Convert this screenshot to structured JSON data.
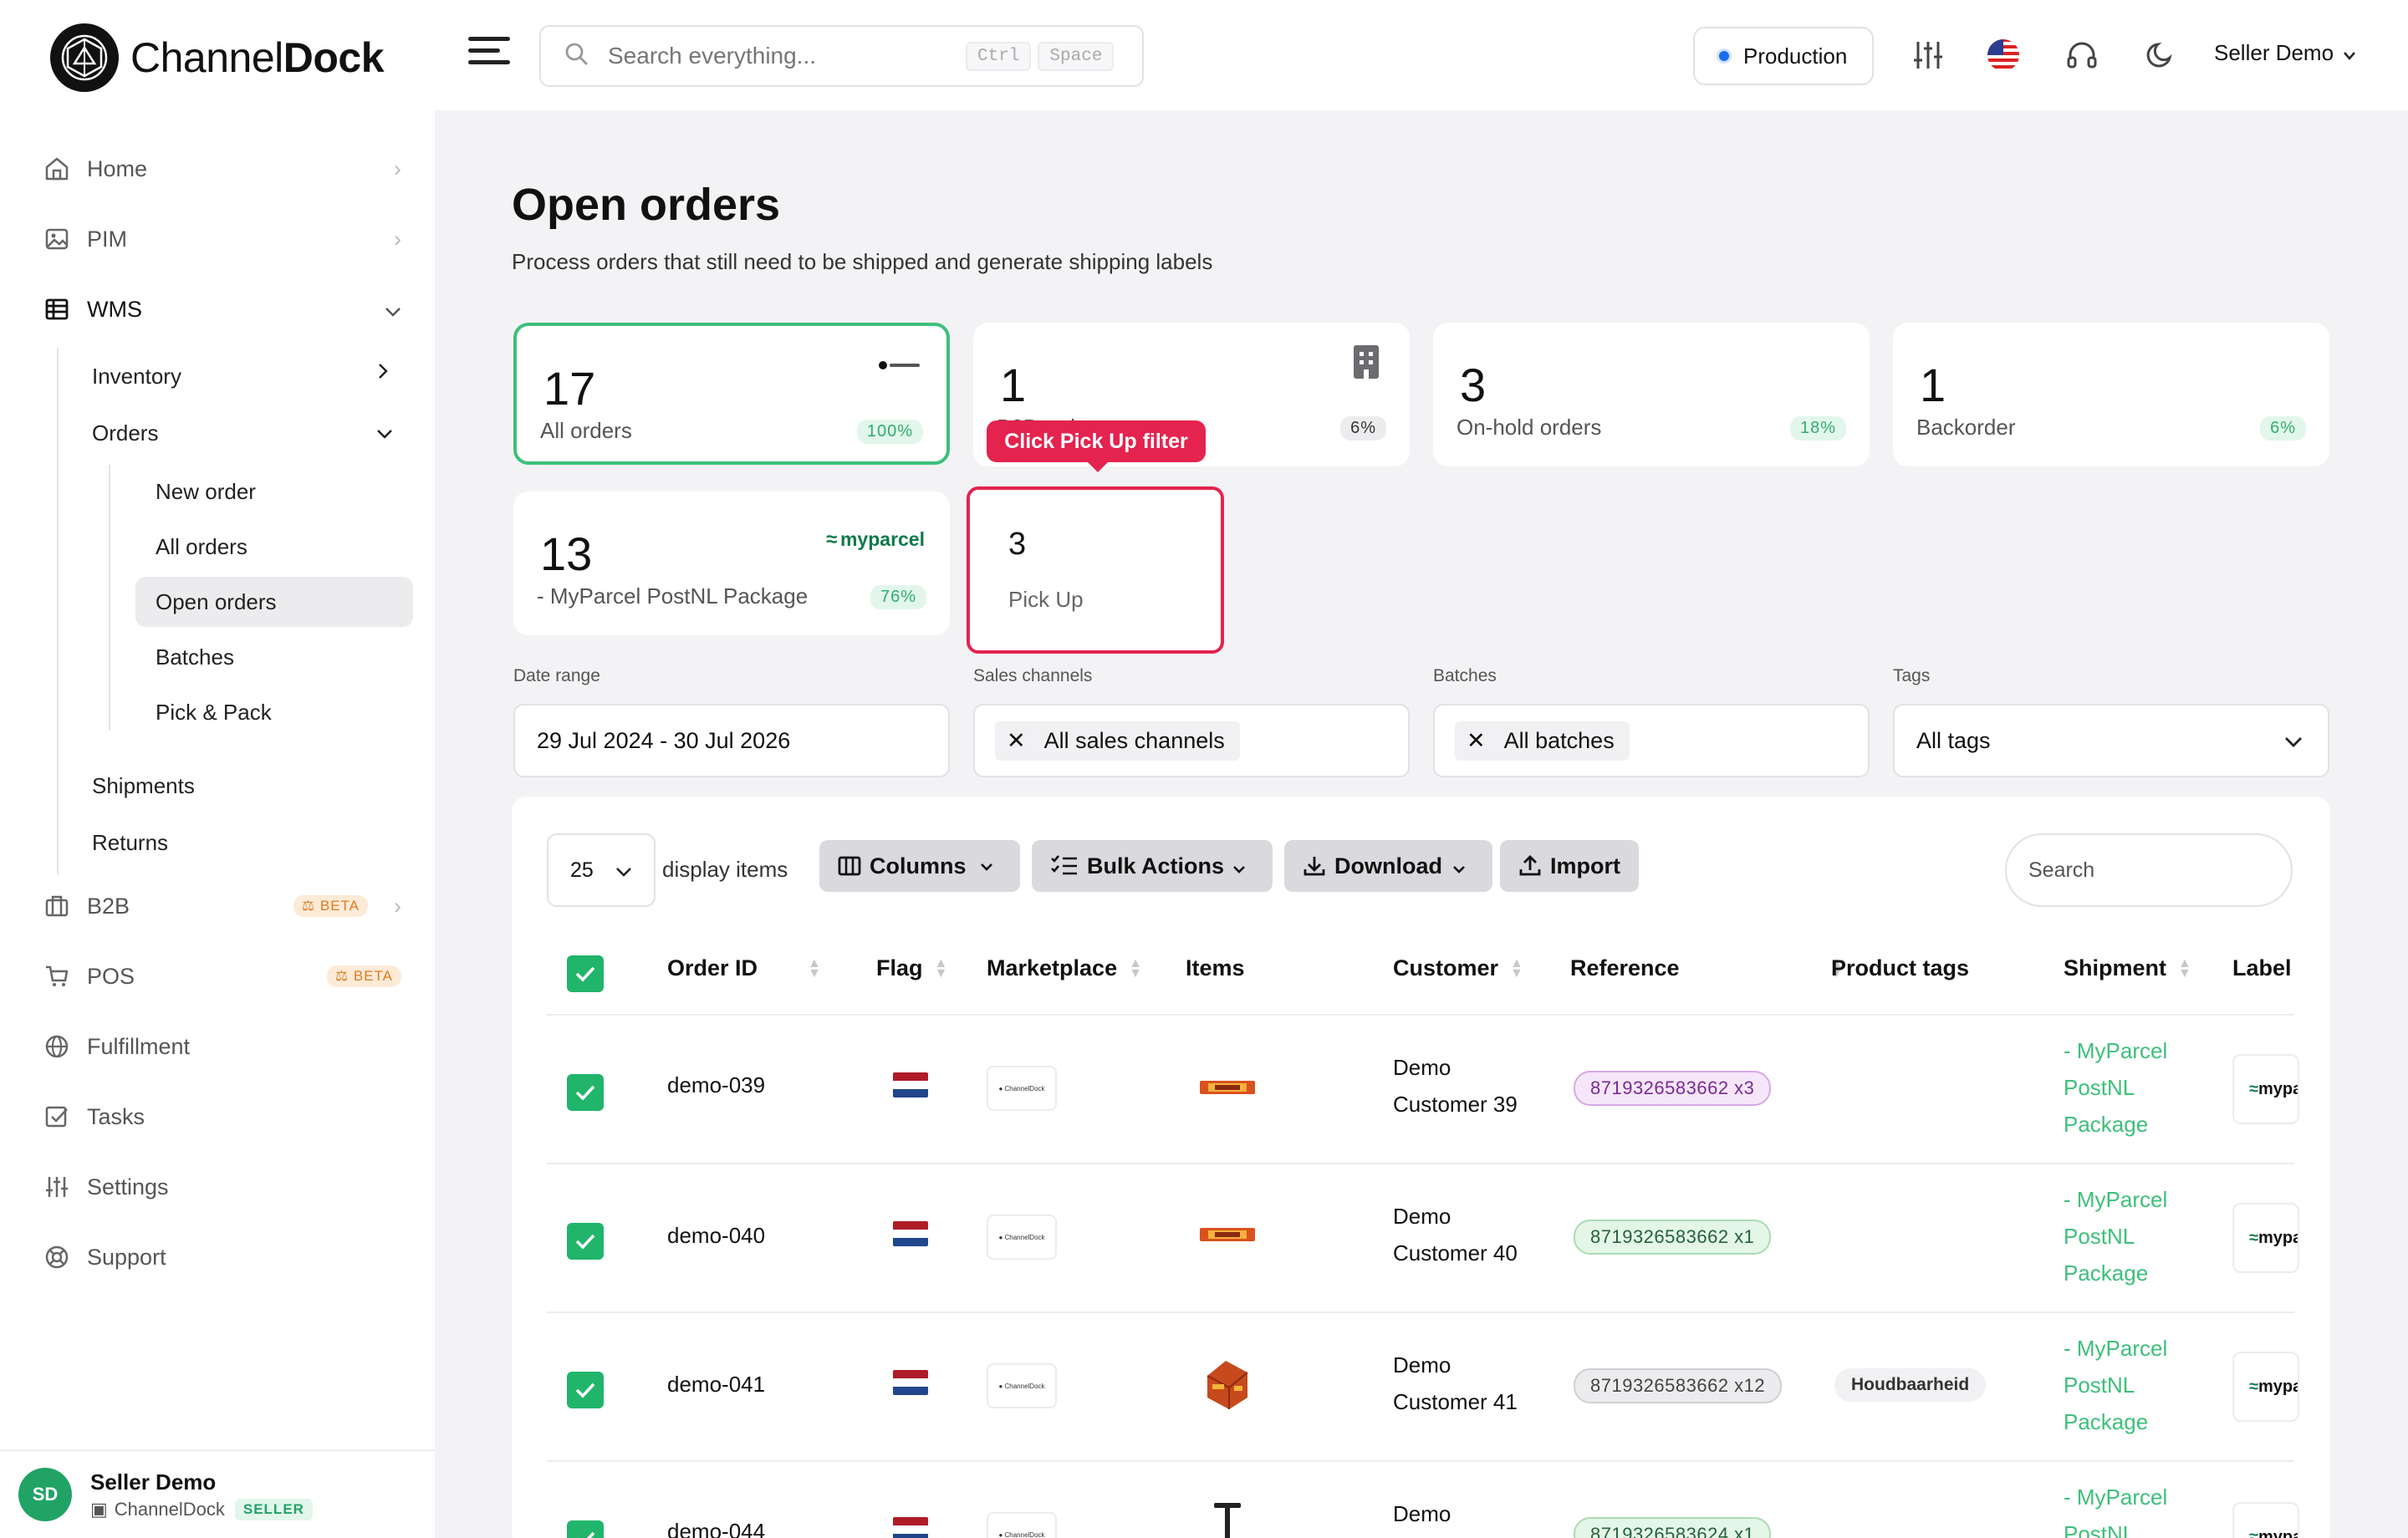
{
  "brand": {
    "name_light": "Channel",
    "name_bold": "Dock"
  },
  "sidebar": {
    "items": [
      {
        "label": "Home"
      },
      {
        "label": "PIM"
      },
      {
        "label": "WMS"
      },
      {
        "label": "B2B",
        "badge": "BETA"
      },
      {
        "label": "POS",
        "badge": "BETA"
      },
      {
        "label": "Fulfillment"
      },
      {
        "label": "Tasks"
      },
      {
        "label": "Settings"
      },
      {
        "label": "Support"
      }
    ],
    "wms_sub": [
      "Inventory",
      "Orders",
      "Shipments",
      "Returns"
    ],
    "orders_sub": [
      "New order",
      "All orders",
      "Open orders",
      "Batches",
      "Pick & Pack"
    ],
    "user": {
      "initials": "SD",
      "name": "Seller Demo",
      "org": "ChannelDock",
      "role": "SELLER"
    }
  },
  "header": {
    "search_placeholder": "Search everything...",
    "kbd1": "Ctrl",
    "kbd2": "Space",
    "environment": "Production",
    "user_menu": "Seller Demo"
  },
  "page": {
    "title": "Open orders",
    "subtitle": "Process orders that still need to be shipped and generate shipping labels"
  },
  "stats": [
    {
      "count": "17",
      "label": "All orders",
      "pct": "100%"
    },
    {
      "count": "1",
      "label": "B2B orders",
      "pct": "6%"
    },
    {
      "count": "3",
      "label": "On-hold orders",
      "pct": "18%"
    },
    {
      "count": "1",
      "label": "Backorder",
      "pct": "6%"
    },
    {
      "count": "13",
      "label": "- MyParcel PostNL Package",
      "pct": "76%",
      "logo": "myparcel"
    }
  ],
  "pickup": {
    "tooltip": "Click Pick Up filter",
    "count": "3",
    "label": "Pick Up"
  },
  "filters": {
    "date_range": {
      "label": "Date range",
      "value": "29 Jul 2024 - 30 Jul 2026"
    },
    "sales_channels": {
      "label": "Sales channels",
      "value": "All sales channels"
    },
    "batches": {
      "label": "Batches",
      "value": "All batches"
    },
    "tags": {
      "label": "Tags",
      "value": "All tags"
    }
  },
  "toolbar": {
    "per_page": "25",
    "display_items": "display items",
    "columns": "Columns",
    "bulk_actions": "Bulk Actions",
    "download": "Download",
    "import": "Import",
    "search_placeholder": "Search"
  },
  "table": {
    "columns": [
      "Order ID",
      "Flag",
      "Marketplace",
      "Items",
      "Customer",
      "Reference",
      "Product tags",
      "Shipment",
      "Label"
    ],
    "rows": [
      {
        "order_id": "demo-039",
        "customer_line1": "Demo",
        "customer_line2": "Customer 39",
        "reference": "8719326583662 x3",
        "ref_color": "purple",
        "tag": "",
        "shipment": [
          "- MyParcel",
          "PostNL",
          "Package"
        ],
        "label": "myparcel"
      },
      {
        "order_id": "demo-040",
        "customer_line1": "Demo",
        "customer_line2": "Customer 40",
        "reference": "8719326583662 x1",
        "ref_color": "green",
        "tag": "",
        "shipment": [
          "- MyParcel",
          "PostNL",
          "Package"
        ],
        "label": "myparcel"
      },
      {
        "order_id": "demo-041",
        "customer_line1": "Demo",
        "customer_line2": "Customer 41",
        "reference": "8719326583662 x12",
        "ref_color": "gray",
        "tag": "Houdbaarheid",
        "shipment": [
          "- MyParcel",
          "PostNL",
          "Package"
        ],
        "label": "myparcel"
      },
      {
        "order_id": "demo-044",
        "customer_line1": "Demo",
        "customer_line2": "",
        "reference": "8719326583624 x1",
        "ref_color": "green",
        "tag": "",
        "shipment": [
          "- MyParcel",
          "PostNL"
        ],
        "label": "myparcel"
      }
    ]
  },
  "colors": {
    "accent_green": "#21b56b",
    "highlight_red": "#e4234f",
    "env_blue": "#1a6cf0"
  }
}
